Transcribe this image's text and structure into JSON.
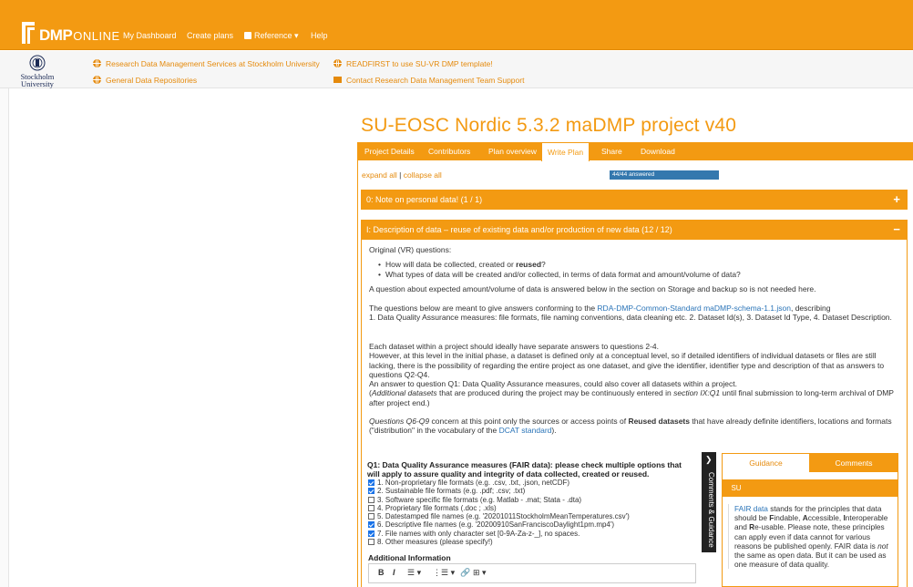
{
  "nav": {
    "logo_dmp": "DMP",
    "logo_online": "ONLINE",
    "links": [
      "My Dashboard",
      "Create plans",
      "Reference",
      "Help"
    ],
    "reference_caret": "▾"
  },
  "org": {
    "name_line1": "Stockholm",
    "name_line2": "University",
    "links_left": [
      "Research Data Management Services at Stockholm University",
      "General Data Repositories"
    ],
    "links_right": [
      "READFIRST to use SU-VR DMP template!",
      "Contact Research Data Management Team Support"
    ]
  },
  "plan": {
    "title": "SU-EOSC Nordic 5.3.2 maDMP project v40",
    "tabs": [
      "Project Details",
      "Contributors",
      "Plan overview",
      "Write Plan",
      "Share",
      "Download"
    ],
    "active_tab": "Write Plan",
    "expand_all": "expand all",
    "separator": "|",
    "collapse_all": "collapse all",
    "progress_label": "44/44 answered",
    "progress_fraction": 1.0
  },
  "sections": [
    {
      "label": "0: Note on personal data! (1 / 1)",
      "toggle": "+"
    },
    {
      "label": "I: Description of data – reuse of existing data and/or production of new data (12 / 12)",
      "toggle": "−"
    }
  ],
  "body": {
    "orig_heading": "Original (VR) questions:",
    "bullet1_a": "How will data be collected, created or ",
    "bullet1_b": "reused",
    "bullet1_c": "?",
    "bullet2": "What types of data will be created and/or collected, in terms of data format and amount/volume of data?",
    "p_amount": "A question about expected amount/volume of data is answered below in the section on Storage and backup so is not needed here.",
    "p_std_a": "The questions below are meant to give answers conforming to the ",
    "p_std_link": "RDA-DMP-Common-Standard maDMP-schema-1.1.json",
    "p_std_b": ", describing",
    "p_std_c": "1. Data Quality Assurance measures: file formats, file naming conventions, data cleaning etc. 2. Dataset Id(s), 3. Dataset Id Type, 4. Dataset Description.",
    "p_each1": "Each dataset within a project should ideally have separate answers to questions 2-4.",
    "p_each2": "However, at this level in the initial phase, a dataset is defined only at a conceptual level, so if detailed identifiers of individual datasets or files are still lacking, there is the possibility of regarding the entire project as one dataset, and give the identifier, identifier type and description of that as answers to questions Q2-Q4.",
    "p_each3": "An answer to question Q1: Data Quality Assurance measures, could also cover all datasets within a project.",
    "p_each4_a": "(",
    "p_each4_b": "Additional datasets",
    "p_each4_c": " that are produced during the project may be continuously entered in ",
    "p_each4_d": "section IX:Q1",
    "p_each4_e": " until final submission to long-term archival of DMP after project end.)",
    "p_q6_a": "Questions Q6-Q9",
    "p_q6_b": " concern at this point only the sources or access points of ",
    "p_q6_c": "Reused datasets",
    "p_q6_d": " that have already definite identifiers, locations and formats (\"distribution\" in the vocabulary of the ",
    "p_q6_link": "DCAT standard",
    "p_q6_e": ")."
  },
  "question": {
    "title": "Q1: Data Quality Assurance measures (FAIR data): please check multiple options that will apply to assure quality and integrity of data collected, created or reused.",
    "options": [
      {
        "label": "1. Non-proprietary file formats (e.g. .csv, .txt, .json, netCDF)",
        "checked": true
      },
      {
        "label": "2. Sustainable file formats (e.g. .pdf; .csv; .txt)",
        "checked": true
      },
      {
        "label": "3. Software specific file formats (e.g. Matlab - .mat; Stata - .dta)",
        "checked": false
      },
      {
        "label": "4. Proprietary file formats (.doc ; .xls)",
        "checked": false
      },
      {
        "label": "5. Datestamped file names (e.g. '20201011StockholmMeanTemperatures.csv')",
        "checked": false
      },
      {
        "label": "6. Descriptive file names (e.g. '20200910SanFranciscoDaylight1pm.mp4')",
        "checked": true
      },
      {
        "label": "7. File names with only character set [0-9A-Za-z-_], no spaces.",
        "checked": true
      },
      {
        "label": "8. Other measures (please specify!)",
        "checked": false
      }
    ],
    "additional_info": "Additional Information",
    "toolbar": {
      "bold": "B",
      "italic": "I",
      "bullets": "☰ ▾",
      "numbers": "⋮☰ ▾",
      "link": "🔗",
      "table": "⊞ ▾"
    }
  },
  "side": {
    "vertical_tab": "Comments & Guidance",
    "chevron": "❯",
    "tab_guidance": "Guidance",
    "tab_comments": "Comments",
    "su_tab": "SU",
    "g_link": "FAIR data",
    "g_t1": " stands for the principles that data should be ",
    "g_F": "F",
    "g_t2": "indable, ",
    "g_A": "A",
    "g_t3": "ccessible, ",
    "g_I": "I",
    "g_t4": "nteroperable and ",
    "g_R": "R",
    "g_t5": "e-usable. Please note, these principles can apply even if data cannot for various reasons be published openly. FAIR data is ",
    "g_not": "not",
    "g_t6": " the same as open data. But it can be used as one measure of data quality."
  },
  "colors": {
    "brand_orange": "#f39a12",
    "link_blue": "#2a74b8",
    "progress_blue": "#3478ae"
  }
}
